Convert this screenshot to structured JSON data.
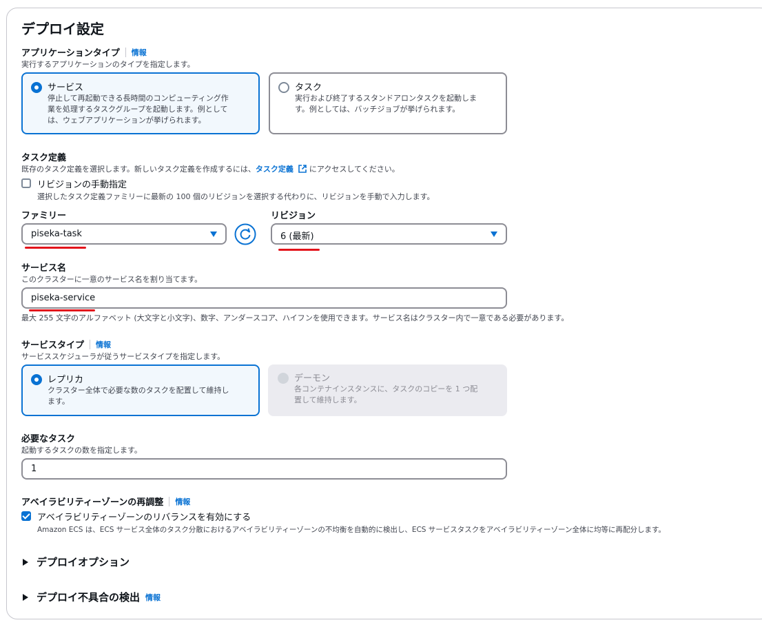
{
  "page_title": "デプロイ設定",
  "app_type": {
    "label": "アプリケーションタイプ",
    "info": "情報",
    "description": "実行するアプリケーションのタイプを指定します。",
    "options": [
      {
        "title": "サービス",
        "desc": [
          "停止して再起動できる長時間のコンピューティング作",
          "業を処理するタスクグループを起動します。例として",
          "は、ウェブアプリケーションが挙げられます。"
        ],
        "selected": true
      },
      {
        "title": "タスク",
        "desc": [
          "実行および終了するスタンドアロンタスクを起動しま",
          "す。例としては、バッチジョブが挙げられます。"
        ],
        "selected": false
      }
    ]
  },
  "task_def": {
    "label": "タスク定義",
    "desc_prefix": "既存のタスク定義を選択します。新しいタスク定義を作成するには、",
    "desc_link": "タスク定義",
    "desc_suffix": " にアクセスしてください。",
    "manual_revision_label": "リビジョンの手動指定",
    "manual_revision_desc": "選択したタスク定義ファミリーに最新の 100 個のリビジョンを選択する代わりに、リビジョンを手動で入力します。",
    "manual_revision_checked": false,
    "family_label": "ファミリー",
    "family_value": "piseka-task",
    "revision_label": "リビジョン",
    "revision_value": "6 (最新)"
  },
  "service_name": {
    "label": "サービス名",
    "description": "このクラスターに一意のサービス名を割り当てます。",
    "value": "piseka-service",
    "constraint": "最大 255 文字のアルファベット (大文字と小文字)、数字、アンダースコア、ハイフンを使用できます。サービス名はクラスター内で一意である必要があります。"
  },
  "service_type": {
    "label": "サービスタイプ",
    "info": "情報",
    "description": "サービススケジューラが従うサービスタイプを指定します。",
    "options": [
      {
        "title": "レプリカ",
        "desc": [
          "クラスター全体で必要な数のタスクを配置して維持し",
          "ます。"
        ],
        "selected": true,
        "disabled": false
      },
      {
        "title": "デーモン",
        "desc": [
          "各コンテナインスタンスに、タスクのコピーを 1 つ配",
          "置して維持します。"
        ],
        "selected": false,
        "disabled": true
      }
    ]
  },
  "desired_tasks": {
    "label": "必要なタスク",
    "description": "起動するタスクの数を指定します。",
    "value": "1"
  },
  "az_rebalance": {
    "label": "アベイラビリティーゾーンの再調整",
    "info": "情報",
    "checkbox_label": "アベイラビリティーゾーンのリバランスを有効にする",
    "checkbox_desc": "Amazon ECS は、ECS サービス全体のタスク分散におけるアベイラビリティーゾーンの不均衡を自動的に検出し、ECS サービスタスクをアベイラビリティーゾーン全体に均等に再配分します。",
    "checked": true
  },
  "expanders": [
    {
      "label": "デプロイオプション",
      "info": ""
    },
    {
      "label": "デプロイ不具合の検出",
      "info": "情報"
    }
  ],
  "colors": {
    "accent": "#0972d3",
    "annotation": "#e3131b",
    "border": "#8c8c94"
  }
}
